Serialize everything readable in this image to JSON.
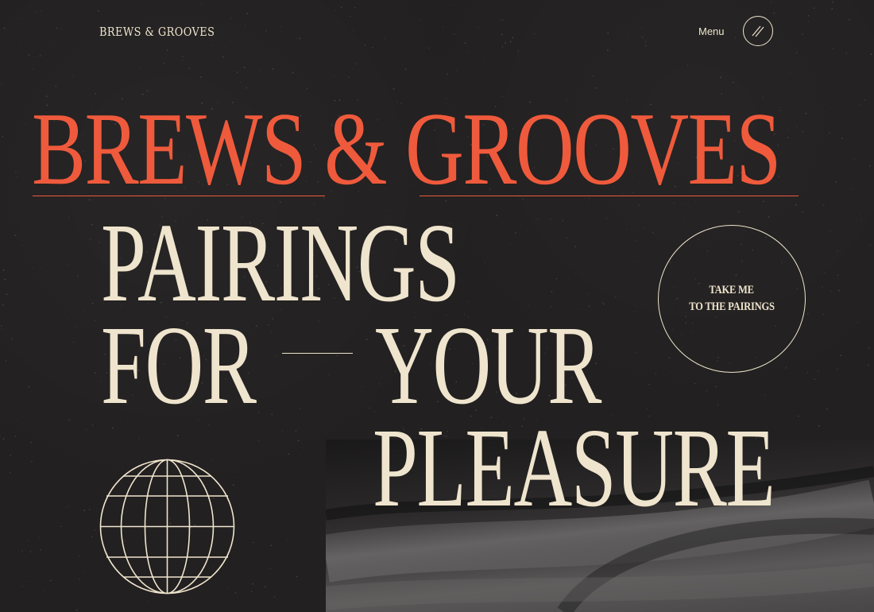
{
  "brand": {
    "logo_text": "BREWS & GROOVES"
  },
  "nav": {
    "menu_label": "Menu",
    "menu_icon": "double-slash-icon"
  },
  "hero": {
    "title": "BREWS & GROOVES",
    "line1": "PAIRINGS",
    "line2_left": "FOR",
    "line2_right": "YOUR",
    "line3": "PLEASURE"
  },
  "cta": {
    "line1": "TAKE ME",
    "line2": "TO THE PAIRINGS"
  },
  "decor": {
    "globe_icon": "wireframe-globe-icon",
    "photo": "vinyl-record-photo"
  },
  "colors": {
    "background": "#222020",
    "accent": "#ef5a3c",
    "cream": "#efe4cd"
  }
}
